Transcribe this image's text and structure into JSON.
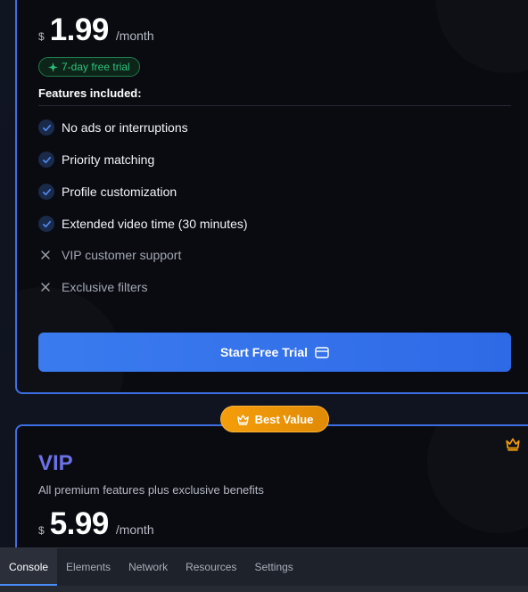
{
  "premium": {
    "currency": "$",
    "amount": "1.99",
    "period": "/month",
    "trial_badge": "7-day free trial",
    "features_title": "Features included:",
    "features": [
      {
        "label": "No ads or interruptions",
        "included": true
      },
      {
        "label": "Priority matching",
        "included": true
      },
      {
        "label": "Profile customization",
        "included": true
      },
      {
        "label": "Extended video time (30 minutes)",
        "included": true
      },
      {
        "label": "VIP customer support",
        "included": false
      },
      {
        "label": "Exclusive filters",
        "included": false
      }
    ],
    "cta_label": "Start Free Trial"
  },
  "best_value_label": "Best Value",
  "vip": {
    "title": "VIP",
    "description": "All premium features plus exclusive benefits",
    "currency": "$",
    "amount": "5.99",
    "period": "/month"
  },
  "devtools": {
    "tabs": [
      "Console",
      "Elements",
      "Network",
      "Resources",
      "Settings"
    ],
    "active_tab": "Console"
  },
  "colors": {
    "accent_blue": "#3a7bef",
    "card_border": "#3d6fe3",
    "vip_purple": "#6b72e6",
    "best_value_orange": "#f59e0b",
    "trial_green": "#2ec27e"
  },
  "icons": {
    "included": "check-icon",
    "excluded": "x-icon",
    "cta": "credit-card-icon",
    "best_value": "crown-icon",
    "trial": "sparkle-icon"
  }
}
